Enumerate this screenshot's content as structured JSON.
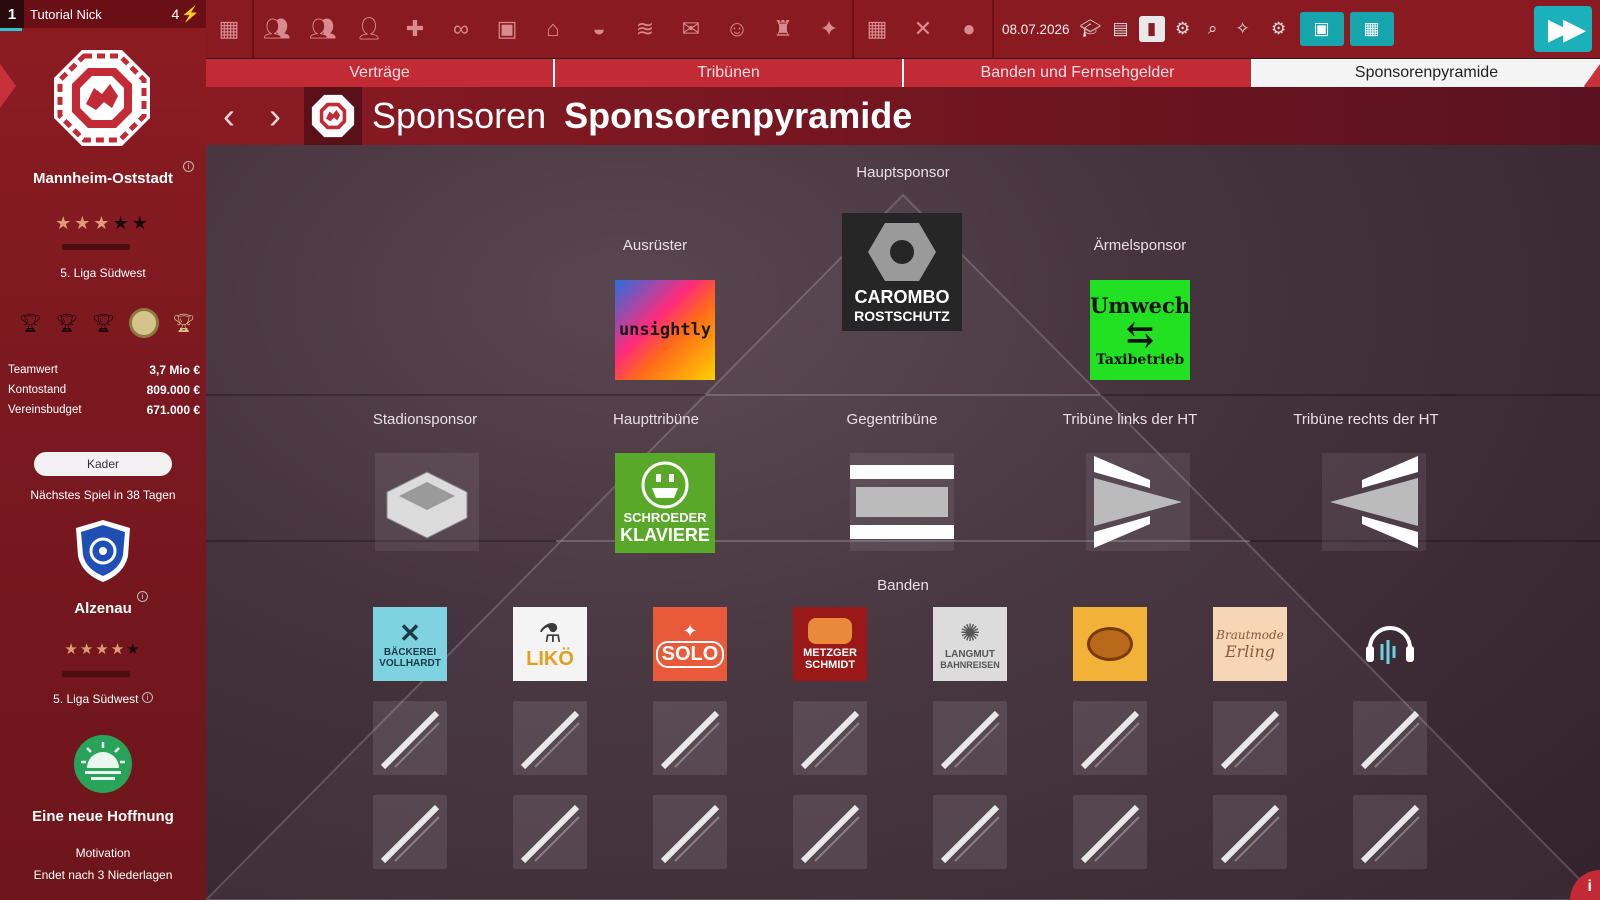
{
  "sidebar": {
    "header": {
      "slot": "1",
      "manager": "Tutorial Nick",
      "count": "4"
    },
    "club": {
      "name": "Mannheim-Oststadt",
      "stars_filled": 3,
      "stars_total": 5,
      "league": "5. Liga Südwest"
    },
    "stats": [
      {
        "label": "Teamwert",
        "value": "3,7 Mio €"
      },
      {
        "label": "Kontostand",
        "value": "809.000 €"
      },
      {
        "label": "Vereinsbudget",
        "value": "671.000 €"
      }
    ],
    "kader_label": "Kader",
    "next_game": "Nächstes Spiel in 38 Tagen",
    "opponent": {
      "name": "Alzenau",
      "stars_filled": 4,
      "stars_total": 5,
      "league": "5. Liga Südwest"
    },
    "mood": {
      "title": "Eine neue Hoffnung",
      "motivation": "Motivation",
      "ends": "Endet nach 3 Niederlagen"
    }
  },
  "topbar": {
    "date": "08.07.2026"
  },
  "tabs": [
    "Verträge",
    "Tribünen",
    "Banden und Fernsehgelder",
    "Sponsorenpyramide"
  ],
  "active_tab": 3,
  "header": {
    "title": "Sponsoren",
    "subtitle": "Sponsorenpyramide"
  },
  "pyramid": {
    "main_label": "Hauptsponsor",
    "main_sponsor": {
      "line1": "CAROMBO",
      "line2": "ROSTSCHUTZ"
    },
    "outfitter_label": "Ausrüster",
    "outfitter": "unsightly",
    "sleeve_label": "Ärmelsponsor",
    "sleeve": {
      "line1": "Umwech",
      "line2": "Taxibetrieb"
    },
    "stadium_label": "Stadionsponsor",
    "main_stand_label": "Haupttribüne",
    "main_stand": {
      "line1": "SCHROEDER",
      "line2": "KLAVIERE"
    },
    "opposite_stand_label": "Gegentribüne",
    "left_stand_label": "Tribüne links der HT",
    "right_stand_label": "Tribüne rechts der HT",
    "boards_label": "Banden",
    "boards": [
      {
        "line1": "BÄCKEREI",
        "line2": "VOLLHARDT"
      },
      {
        "line1": "LIKÖ",
        "line2": ""
      },
      {
        "line1": "SOLO",
        "line2": ""
      },
      {
        "line1": "METZGER",
        "line2": "SCHMIDT"
      },
      {
        "line1": "LANGMUT",
        "line2": "BAHNREISEN"
      },
      {
        "line1": "",
        "line2": ""
      },
      {
        "line1": "Brautmode",
        "line2": "Erling"
      },
      {
        "line1": "",
        "line2": ""
      }
    ]
  },
  "colors": {
    "accent": "#c22a35",
    "teal": "#1ab1bb",
    "sidebar": "#8e1c22"
  }
}
